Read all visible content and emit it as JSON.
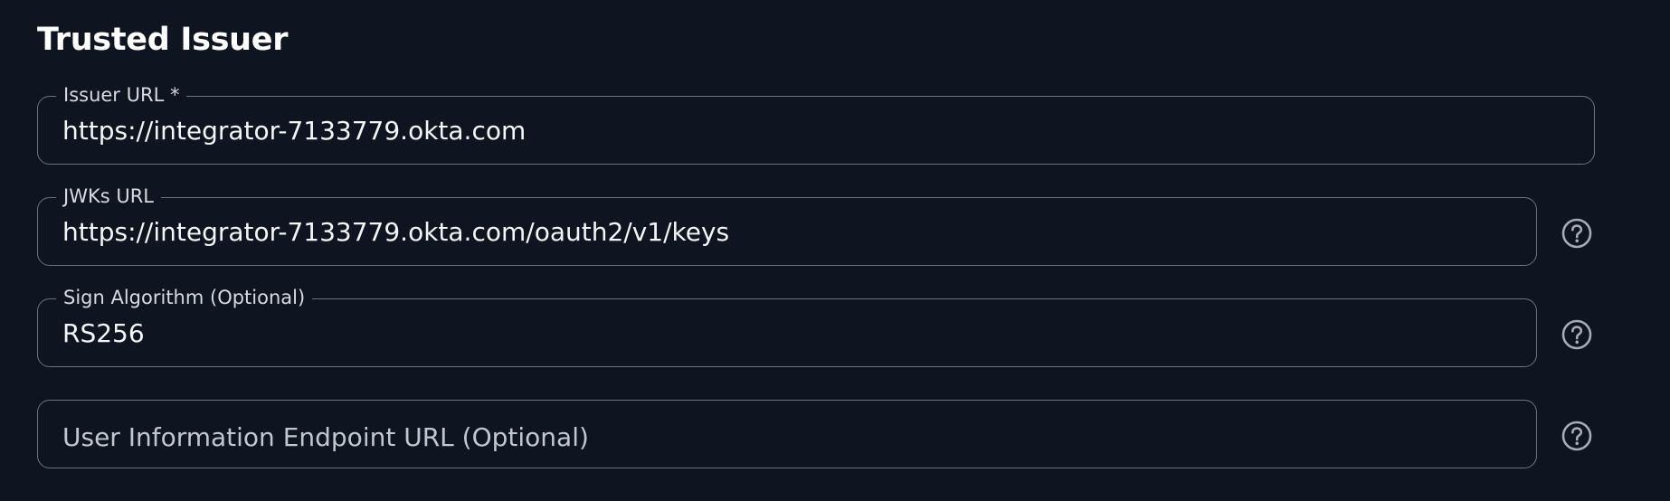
{
  "section": {
    "title": "Trusted Issuer"
  },
  "fields": {
    "issuer_url": {
      "label": "Issuer URL *",
      "value": "https://integrator-7133779.okta.com"
    },
    "jwks_url": {
      "label": "JWKs URL",
      "value": "https://integrator-7133779.okta.com/oauth2/v1/keys",
      "help_icon": "question-circle-icon"
    },
    "sign_algorithm": {
      "label": "Sign Algorithm (Optional)",
      "value": "RS256",
      "help_icon": "question-circle-icon"
    },
    "user_info_endpoint": {
      "placeholder": "User Information Endpoint URL (Optional)",
      "value": "",
      "help_icon": "question-circle-icon"
    }
  },
  "colors": {
    "background": "#0f1520",
    "border": "#6d7480",
    "text": "#f3f5f8",
    "label": "#d6dae0",
    "icon": "#a6acb5"
  }
}
